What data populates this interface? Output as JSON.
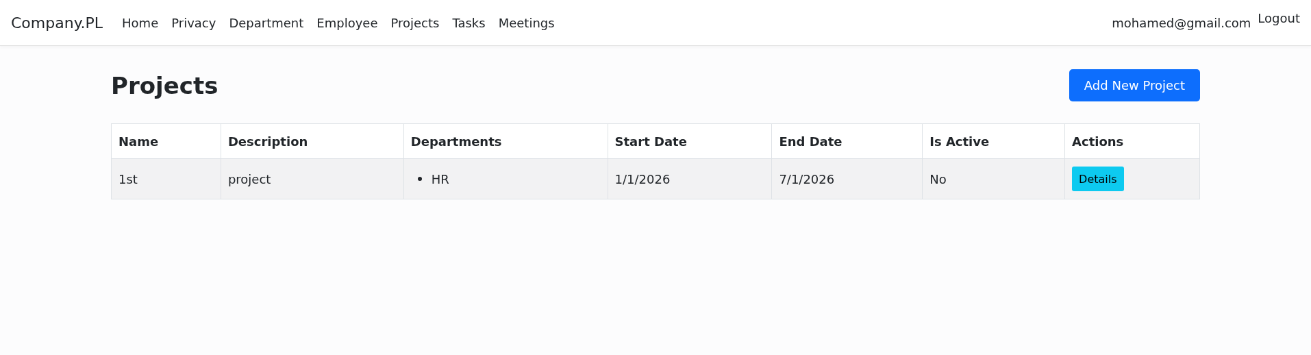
{
  "navbar": {
    "brand": "Company.PL",
    "links": [
      {
        "label": "Home"
      },
      {
        "label": "Privacy"
      },
      {
        "label": "Department"
      },
      {
        "label": "Employee"
      },
      {
        "label": "Projects"
      },
      {
        "label": "Tasks"
      },
      {
        "label": "Meetings"
      }
    ],
    "user": "mohamed@gmail.com",
    "logout": "Logout"
  },
  "page": {
    "title": "Projects",
    "add_button": "Add New Project"
  },
  "table": {
    "columns": [
      "Name",
      "Description",
      "Departments",
      "Start Date",
      "End Date",
      "Is Active",
      "Actions"
    ],
    "rows": [
      {
        "name": "1st",
        "description": "project",
        "departments": [
          "HR"
        ],
        "start_date": "1/1/2026",
        "end_date": "7/1/2026",
        "is_active": "No",
        "action": "Details"
      }
    ]
  }
}
